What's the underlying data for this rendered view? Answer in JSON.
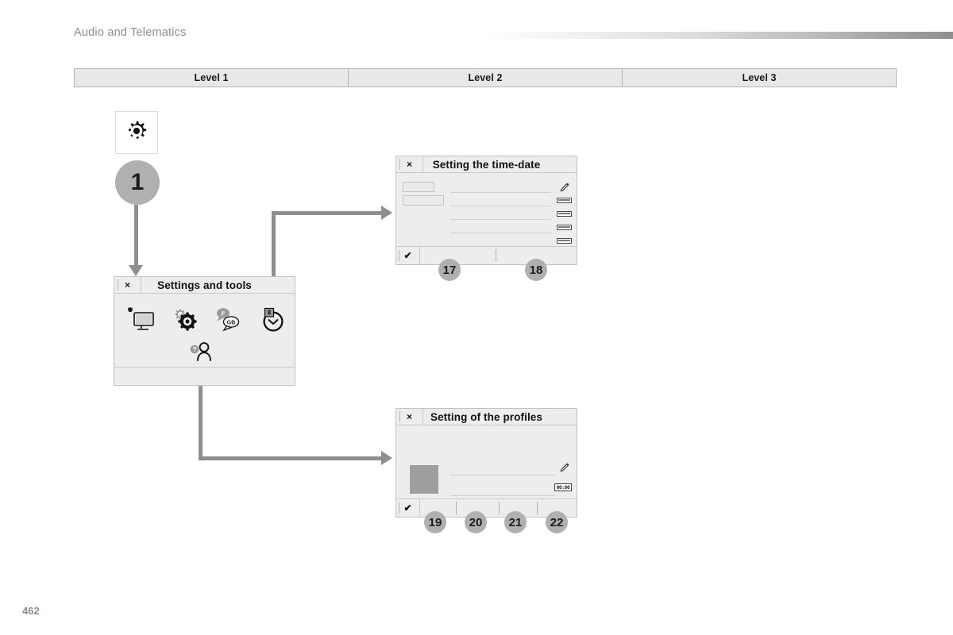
{
  "header": {
    "section_title": "Audio and Telematics"
  },
  "level_table": {
    "columns": [
      "Level 1",
      "Level 2",
      "Level 3"
    ]
  },
  "flow": {
    "entry_icon": "gear-icon",
    "step_badge": "1"
  },
  "settings_panel": {
    "close_label": "×",
    "title": "Settings and tools",
    "icons": [
      {
        "name": "display-brightness-icon",
        "label": ""
      },
      {
        "name": "settings-gear-icon",
        "label": ""
      },
      {
        "name": "language-bubble-icon",
        "label_primary": "F",
        "label_secondary": "GB"
      },
      {
        "name": "clock-time-icon",
        "label": "8"
      },
      {
        "name": "user-profile-help-icon",
        "label": "?"
      }
    ]
  },
  "time_date_panel": {
    "close_label": "×",
    "title": "Setting the time-date",
    "confirm_label": "✔",
    "rows": [
      {
        "indicator": "pencil-icon"
      },
      {
        "indicator": "dash-icon"
      },
      {
        "indicator": "dash-icon"
      },
      {
        "indicator": "dash-icon"
      },
      {
        "indicator": "dash-icon"
      }
    ],
    "badges": [
      "17",
      "18"
    ]
  },
  "profiles_panel": {
    "close_label": "×",
    "title": "Setting of the profiles",
    "confirm_label": "✔",
    "avatar": "profile-thumbnail",
    "rows": [
      {
        "indicator": "pencil-icon"
      },
      {
        "indicator": "digital-clock-icon",
        "value": "00:00"
      }
    ],
    "badges": [
      "19",
      "20",
      "21",
      "22"
    ]
  },
  "footer": {
    "page_number": "462"
  },
  "colors": {
    "panel_bg": "#eceded",
    "panel_border": "#c2c2c2",
    "badge_gray": "#b0b0b0",
    "arrow_gray": "#8f8f8f",
    "table_header_bg": "#e6e8e9",
    "muted_text": "#8d8d8d"
  }
}
